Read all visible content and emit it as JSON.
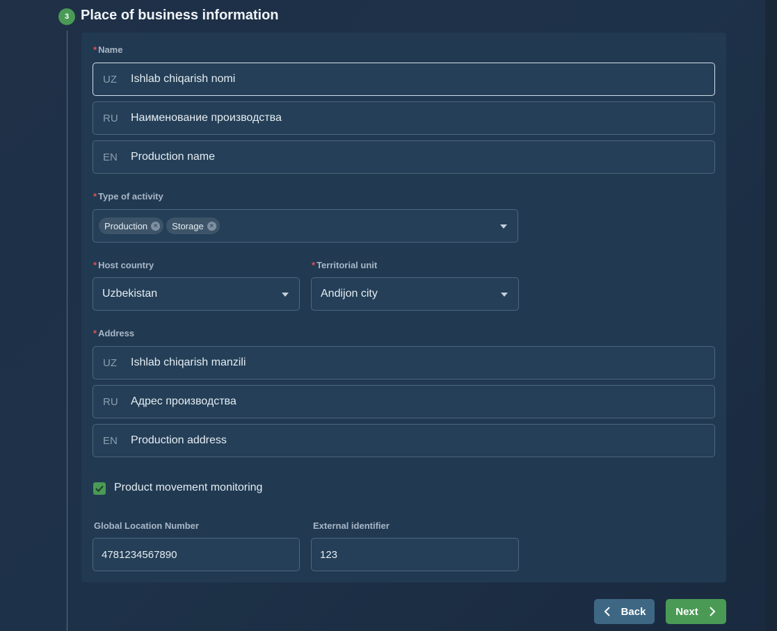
{
  "section": {
    "step_number": "3",
    "title": "Place of business information"
  },
  "name": {
    "label": "Name",
    "required_mark": "*",
    "fields": [
      {
        "lang": "UZ",
        "value": "Ishlab chiqarish nomi"
      },
      {
        "lang": "RU",
        "value": "Наименование производства"
      },
      {
        "lang": "EN",
        "value": "Production name"
      }
    ]
  },
  "activity": {
    "label": "Type of activity",
    "required_mark": "*",
    "chips": [
      "Production",
      "Storage"
    ],
    "icon": "chevron-down-icon"
  },
  "host_country": {
    "label": "Host country",
    "required_mark": "*",
    "value": "Uzbekistan"
  },
  "territorial_unit": {
    "label": "Territorial unit",
    "required_mark": "*",
    "value": "Andijon city"
  },
  "address": {
    "label": "Address",
    "required_mark": "*",
    "fields": [
      {
        "lang": "UZ",
        "value": "Ishlab chiqarish manzili"
      },
      {
        "lang": "RU",
        "value": "Адрес производства"
      },
      {
        "lang": "EN",
        "value": "Production address"
      }
    ]
  },
  "monitoring": {
    "label": "Product movement monitoring",
    "checked": true
  },
  "gln": {
    "label": "Global Location Number",
    "value": "4781234567890"
  },
  "external_id": {
    "label": "External identifier",
    "value": "123"
  },
  "nav": {
    "back_label": "Back",
    "next_label": "Next"
  },
  "colors": {
    "accent_green": "#4a9a56",
    "back_button": "#3e6784",
    "required": "#e0534f"
  }
}
